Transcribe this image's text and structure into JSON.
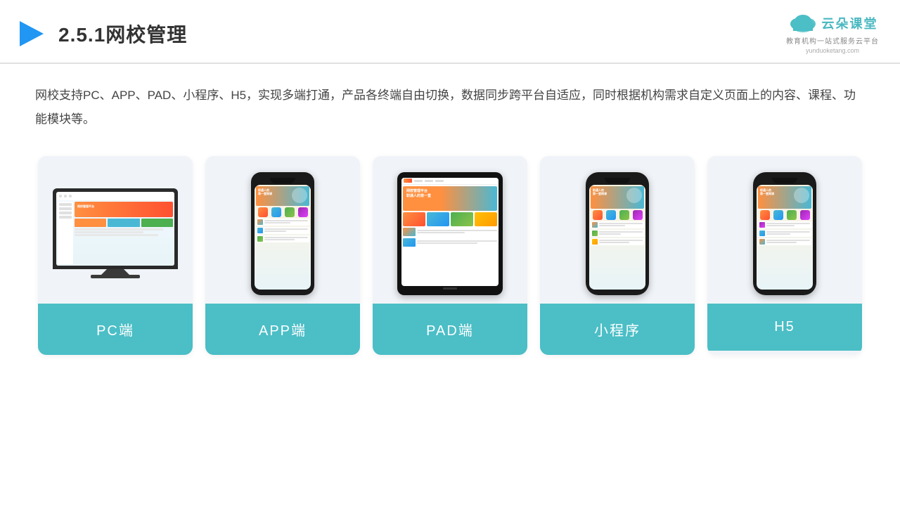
{
  "header": {
    "title": "2.5.1网校管理",
    "logo": {
      "name": "云朵课堂",
      "url": "yunduoketang.com",
      "tagline": "教育机构一站\n式服务云平台"
    }
  },
  "description": "网校支持PC、APP、PAD、小程序、H5，实现多端打通，产品各终端自由切换，数据同步跨平台自适应，同时根据机构需求自定义页面上的内容、课程、功能模块等。",
  "cards": [
    {
      "id": "pc",
      "label": "PC端"
    },
    {
      "id": "app",
      "label": "APP端"
    },
    {
      "id": "pad",
      "label": "PAD端"
    },
    {
      "id": "miniprogram",
      "label": "小程序"
    },
    {
      "id": "h5",
      "label": "H5"
    }
  ],
  "colors": {
    "teal": "#4bbec6",
    "accent_orange": "#ff9040",
    "text_dark": "#333333",
    "text_body": "#444444",
    "bg_card": "#f0f4f8",
    "border": "#e0e0e0"
  }
}
